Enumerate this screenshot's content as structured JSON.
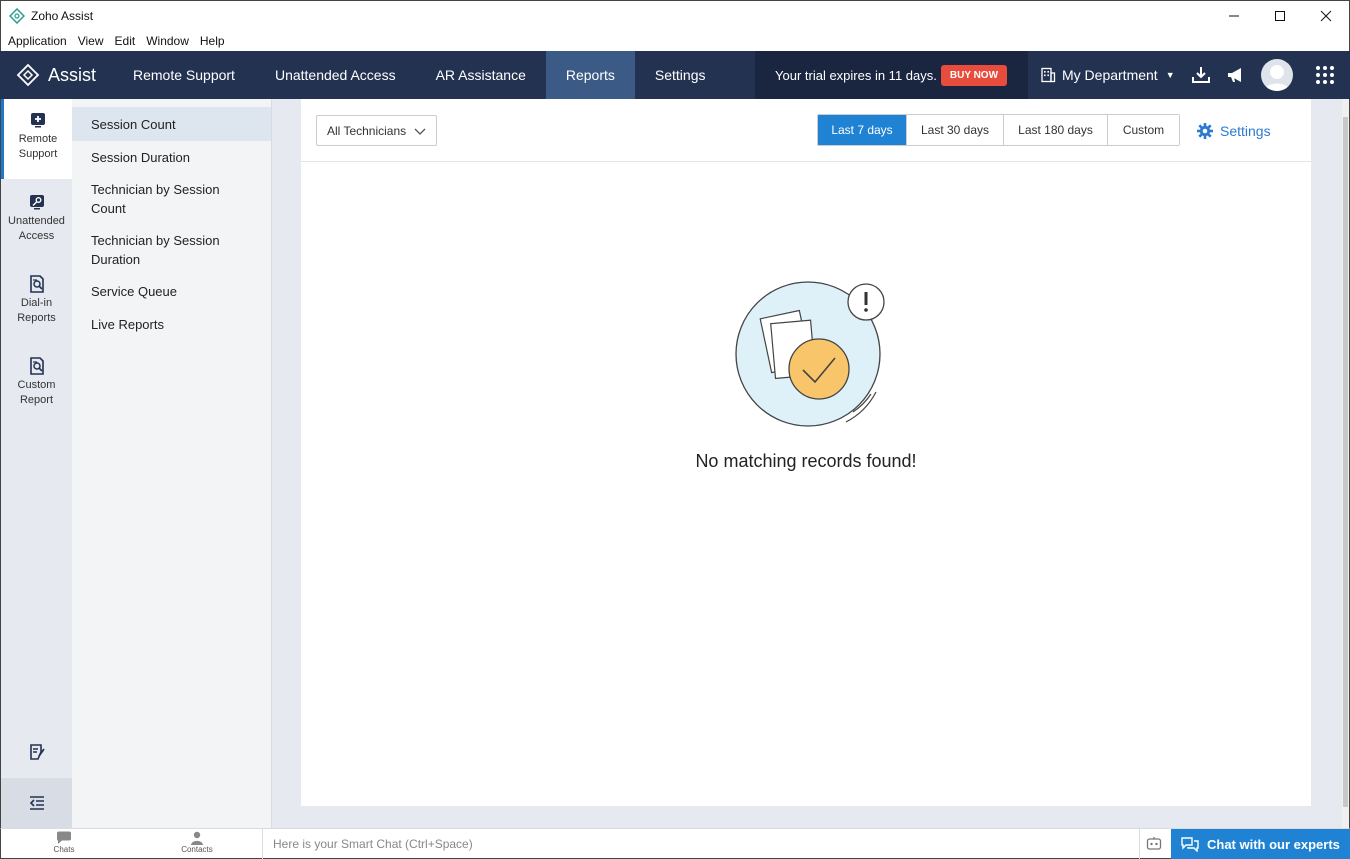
{
  "window": {
    "title": "Zoho Assist",
    "controls": [
      "minimize-icon",
      "maximize-icon",
      "close-icon"
    ]
  },
  "menubar": {
    "items": [
      "Application",
      "View",
      "Edit",
      "Window",
      "Help"
    ]
  },
  "topnav": {
    "logo_text": "Assist",
    "tabs": [
      {
        "label": "Remote Support",
        "active": false
      },
      {
        "label": "Unattended Access",
        "active": false
      },
      {
        "label": "AR Assistance",
        "active": false
      },
      {
        "label": "Reports",
        "active": true
      },
      {
        "label": "Settings",
        "active": false
      }
    ],
    "trial_text": "Your trial expires in 11 days.",
    "buy_label": "BUY NOW",
    "department": "My Department",
    "icons": [
      "download-icon",
      "announcement-icon",
      "avatar",
      "apps-grid-icon"
    ]
  },
  "rail": {
    "items": [
      {
        "label_line1": "Remote",
        "label_line2": "Support",
        "icon": "plus-box-icon",
        "active": true
      },
      {
        "label_line1": "Unattended",
        "label_line2": "Access",
        "icon": "key-icon",
        "active": false
      },
      {
        "label_line1": "Dial-in",
        "label_line2": "Reports",
        "icon": "report-search-icon",
        "active": false
      },
      {
        "label_line1": "Custom",
        "label_line2": "Report",
        "icon": "report-search-icon",
        "active": false
      }
    ],
    "bottom_icons": [
      "feedback-icon",
      "collapse-icon"
    ]
  },
  "subnav": {
    "items": [
      {
        "label": "Session Count",
        "active": true
      },
      {
        "label": "Session Duration",
        "active": false
      },
      {
        "label_line1": "Technician by Session",
        "label_line2": "Count",
        "active": false
      },
      {
        "label_line1": "Technician by Session",
        "label_line2": "Duration",
        "active": false
      },
      {
        "label": "Service Queue",
        "active": false
      },
      {
        "label": "Live Reports",
        "active": false
      }
    ]
  },
  "filters": {
    "technician": "All Technicians",
    "ranges": [
      {
        "label": "Last 7 days",
        "active": true
      },
      {
        "label": "Last 30 days",
        "active": false
      },
      {
        "label": "Last 180 days",
        "active": false
      },
      {
        "label": "Custom",
        "active": false
      }
    ],
    "settings_label": "Settings"
  },
  "empty_state": {
    "message": "No matching records found!"
  },
  "bottombar": {
    "chats_label": "Chats",
    "contacts_label": "Contacts",
    "smartchat_placeholder": "Here is your Smart Chat (Ctrl+Space)",
    "chat_experts_label": "Chat with our experts"
  },
  "colors": {
    "nav_bg": "#243252",
    "nav_active": "#3c5a86",
    "accent_blue": "#1f82d3",
    "buy_red": "#e74c3c",
    "illus_circle": "#dff1f8",
    "illus_check": "#f9c56a"
  }
}
